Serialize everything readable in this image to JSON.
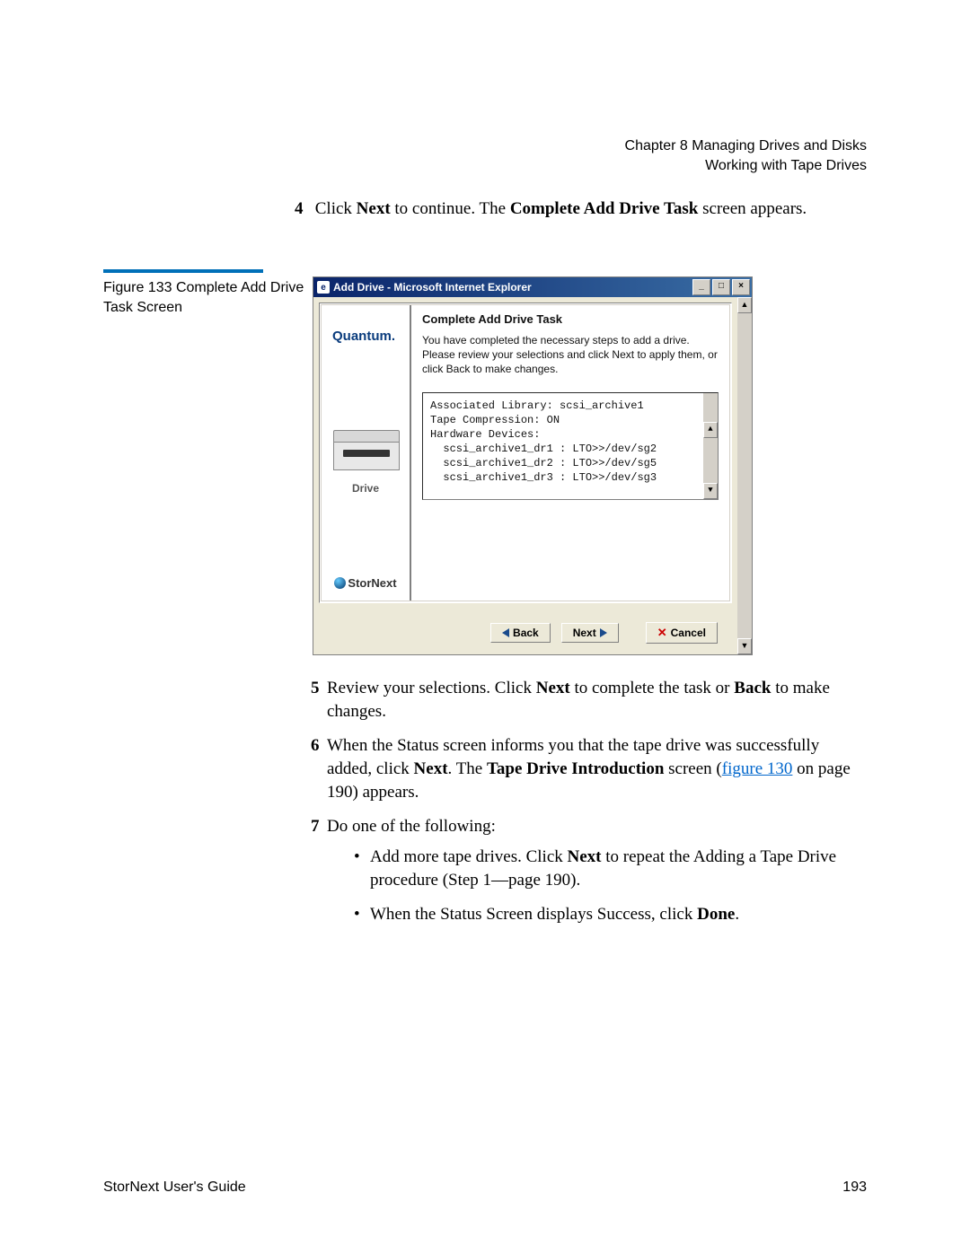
{
  "header": {
    "chapter": "Chapter 8  Managing Drives and Disks",
    "section": "Working with Tape Drives"
  },
  "step4": {
    "num": "4",
    "pre": "Click ",
    "next": "Next",
    "mid": " to continue. The ",
    "screen": "Complete Add Drive Task",
    "post": " screen appears."
  },
  "figure": {
    "caption": "Figure 133  Complete Add Drive Task Screen"
  },
  "dialog": {
    "title": "Add Drive - Microsoft Internet Explorer",
    "brand": "Quantum.",
    "drive_label": "Drive",
    "product": "StorNext",
    "task_title": "Complete Add Drive Task",
    "task_desc": "You have completed the necessary steps to add a drive. Please review your selections and click Next to apply them, or click Back to make changes.",
    "summary": "Associated Library: scsi_archive1\nTape Compression: ON\nHardware Devices:\n  scsi_archive1_dr1 : LTO>>/dev/sg2\n  scsi_archive1_dr2 : LTO>>/dev/sg5\n  scsi_archive1_dr3 : LTO>>/dev/sg3",
    "buttons": {
      "back": "Back",
      "next": "Next",
      "cancel": "Cancel"
    },
    "win": {
      "min": "_",
      "max": "□",
      "close": "×"
    },
    "scroll": {
      "up": "▲",
      "down": "▼"
    }
  },
  "step5": {
    "num": "5",
    "pre": "Review your selections. Click ",
    "next": "Next",
    "mid": " to complete the task or ",
    "back": "Back",
    "post": " to make changes."
  },
  "step6": {
    "num": "6",
    "pre": "When the Status screen informs you that the tape drive was successfully added, click ",
    "next": "Next",
    "mid1": ". The ",
    "screen": "Tape Drive Introduction",
    "mid2": " screen (",
    "figref": "figure 130",
    "post": " on page 190) appears."
  },
  "step7": {
    "num": "7",
    "text": "Do one of the following:",
    "bullet1_pre": "Add more tape drives. Click ",
    "bullet1_next": "Next",
    "bullet1_post": " to repeat the Adding a Tape Drive procedure (Step 1—page 190).",
    "bullet2_pre": "When the Status Screen displays Success, click ",
    "bullet2_done": "Done",
    "bullet2_post": "."
  },
  "footer": {
    "left": "StorNext User's Guide",
    "right": "193"
  }
}
